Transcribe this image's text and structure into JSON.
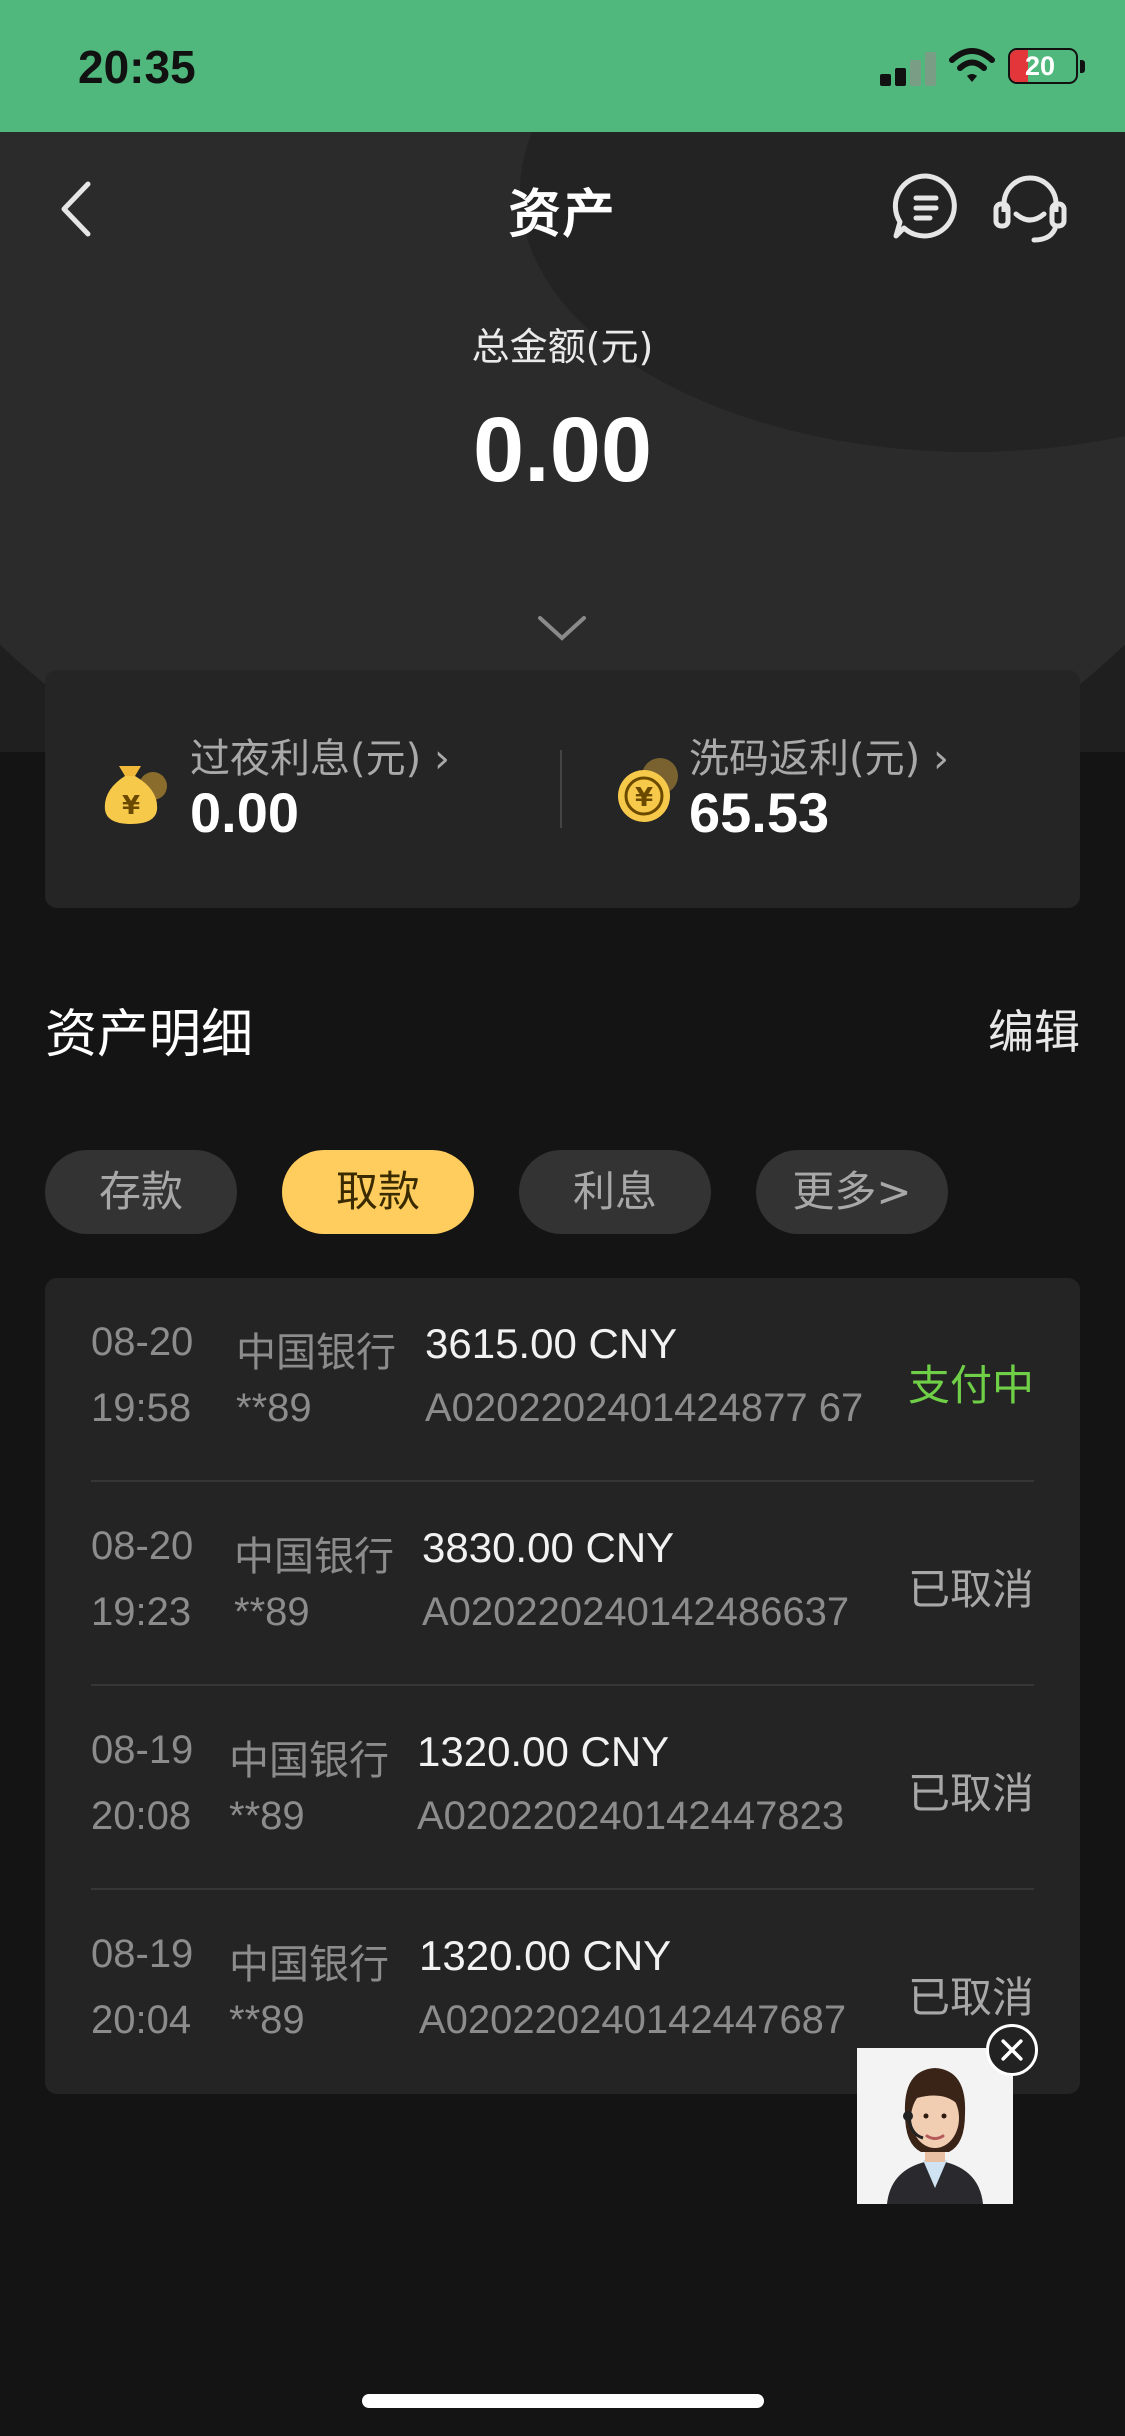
{
  "status_bar": {
    "time": "20:35",
    "battery": "20"
  },
  "header": {
    "title": "资产"
  },
  "total": {
    "label": "总金额(元)",
    "value": "0.00"
  },
  "summary": [
    {
      "label": "过夜利息(元)",
      "arrow": "›",
      "value": "0.00",
      "icon": "money-bag-icon"
    },
    {
      "label": "洗码返利(元)",
      "arrow": "›",
      "value": "65.53",
      "icon": "coin-exchange-icon"
    }
  ],
  "details": {
    "title": "资产明细",
    "edit_label": "编辑",
    "tabs": [
      "存款",
      "取款",
      "利息",
      "更多>"
    ],
    "active_tab": "取款"
  },
  "records": [
    {
      "date": "08-20",
      "time": "19:58",
      "bank": "中国银行",
      "card": "**89",
      "amount": "3615.00 CNY",
      "order": "A0202202401424877 67",
      "status": "支付中"
    },
    {
      "date": "08-20",
      "time": "19:23",
      "bank": "中国银行",
      "card": "**89",
      "amount": "3830.00 CNY",
      "order": "A020220240142486637",
      "status": "已取消"
    },
    {
      "date": "08-19",
      "time": "20:08",
      "bank": "中国银行",
      "card": "**89",
      "amount": "1320.00 CNY",
      "order": "A020220240142447823",
      "status": "已取消"
    },
    {
      "date": "08-19",
      "time": "20:04",
      "bank": "中国银行",
      "card": "**89",
      "amount": "1320.00 CNY",
      "order": "A020220240142447687",
      "status": "已取消"
    }
  ],
  "colors": {
    "accent": "#ffcd5d",
    "status_green": "#6fcf46",
    "status_bar": "#50b87c"
  }
}
